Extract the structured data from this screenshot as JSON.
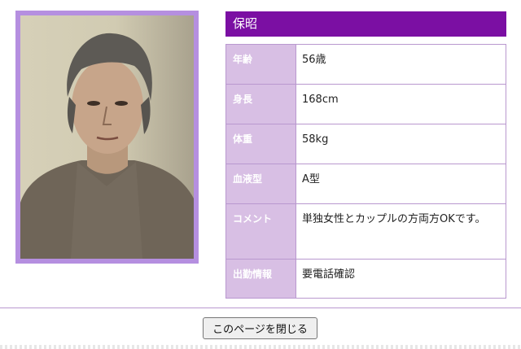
{
  "profile": {
    "name": "保昭",
    "rows": [
      {
        "key": "年齢",
        "value": "56歳"
      },
      {
        "key": "身長",
        "value": "168cm"
      },
      {
        "key": "体重",
        "value": "58kg"
      },
      {
        "key": "血液型",
        "value": "A型"
      },
      {
        "key": "コメント",
        "value": "単独女性とカップルの方両方OKです。"
      },
      {
        "key": "出勤情報",
        "value": "要電話確認"
      }
    ]
  },
  "actions": {
    "close_label": "このページを閉じる"
  },
  "colors": {
    "accent": "#7b0fa3",
    "frame": "#b58fe0",
    "key_bg": "#d8bfe4",
    "border": "#b998cf"
  }
}
